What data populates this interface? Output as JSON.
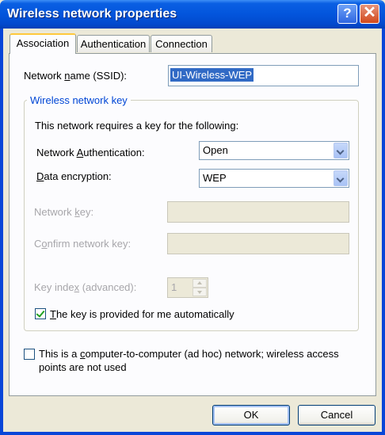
{
  "window": {
    "title": "Wireless network properties",
    "help_glyph": "?",
    "close_glyph": "✕"
  },
  "tabs": [
    {
      "label": "Association",
      "active": true
    },
    {
      "label": "Authentication",
      "active": false
    },
    {
      "label": "Connection",
      "active": false
    }
  ],
  "association": {
    "ssid_label_pre": "Network ",
    "ssid_label_u": "n",
    "ssid_label_post": "ame (SSID):",
    "ssid_value": "UI-Wireless-WEP",
    "group_title": "Wireless network key",
    "group_desc": "This network requires a key for the following:",
    "auth_label_pre": "Network ",
    "auth_label_u": "A",
    "auth_label_post": "uthentication:",
    "auth_value": "Open",
    "enc_label_u": "D",
    "enc_label_post": "ata encryption:",
    "enc_value": "WEP",
    "netkey_label_pre": "Network ",
    "netkey_label_u": "k",
    "netkey_label_post": "ey:",
    "confirm_label_pre": "C",
    "confirm_label_u": "o",
    "confirm_label_post": "nfirm network key:",
    "keyindex_label_pre": "Key inde",
    "keyindex_label_u": "x",
    "keyindex_label_post": " (advanced):",
    "keyindex_value": "1",
    "autokey_label_u": "T",
    "autokey_label_post": "he key is provided for me automatically",
    "autokey_checked": true,
    "adhoc_line1_pre": "This is a ",
    "adhoc_line1_u": "c",
    "adhoc_line1_post": "omputer-to-computer (ad hoc) network; wireless access",
    "adhoc_line2": "points are not used",
    "adhoc_checked": false
  },
  "buttons": {
    "ok": "OK",
    "cancel": "Cancel"
  },
  "colors": {
    "title_bar": "#0355DC",
    "dialog_bg": "#ECE9D8",
    "group_title": "#0046D5",
    "selection": "#316AC5",
    "check": "#21A121"
  }
}
